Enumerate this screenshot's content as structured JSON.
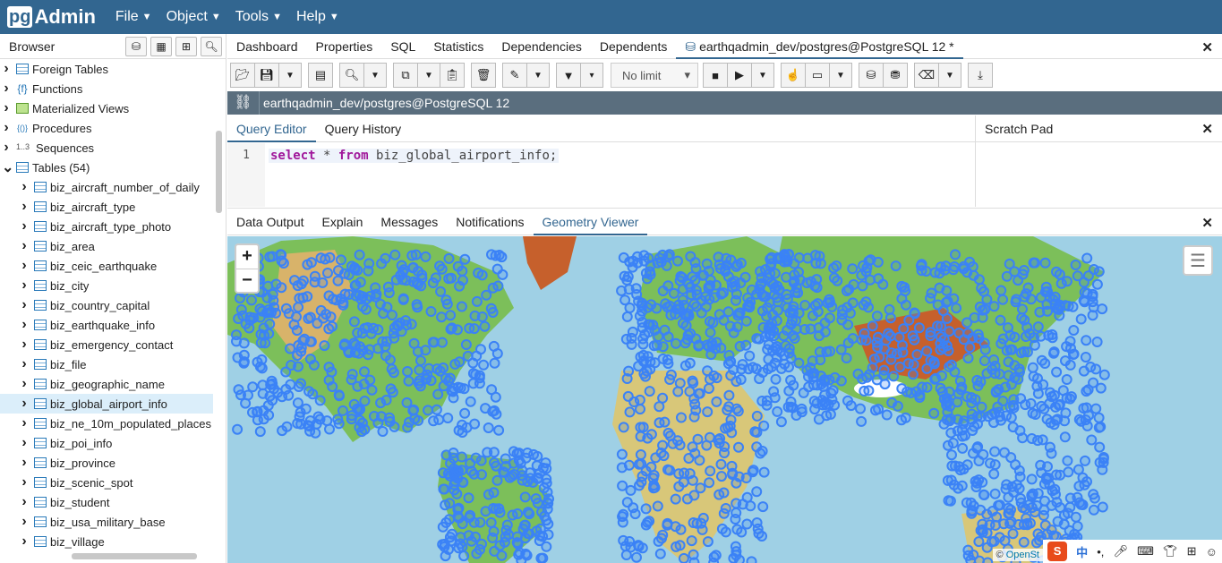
{
  "app": {
    "logo_pg": "pg",
    "logo_admin": "Admin",
    "menu": [
      {
        "label": "File"
      },
      {
        "label": "Object"
      },
      {
        "label": "Tools"
      },
      {
        "label": "Help"
      }
    ]
  },
  "browser": {
    "title": "Browser",
    "tree": [
      {
        "label": "Foreign Tables",
        "indent": 0,
        "icon": "foreign-table-icon"
      },
      {
        "label": "Functions",
        "indent": 0,
        "icon": "function-icon"
      },
      {
        "label": "Materialized Views",
        "indent": 0,
        "icon": "materialized-view-icon"
      },
      {
        "label": "Procedures",
        "indent": 0,
        "icon": "procedure-icon"
      },
      {
        "label": "Sequences",
        "indent": 0,
        "icon": "sequence-icon"
      },
      {
        "label": "Tables (54)",
        "indent": 0,
        "icon": "tables-icon",
        "expanded": true
      },
      {
        "label": "biz_aircraft_number_of_daily",
        "indent": 1,
        "icon": "table-icon"
      },
      {
        "label": "biz_aircraft_type",
        "indent": 1,
        "icon": "table-icon"
      },
      {
        "label": "biz_aircraft_type_photo",
        "indent": 1,
        "icon": "table-icon"
      },
      {
        "label": "biz_area",
        "indent": 1,
        "icon": "table-icon"
      },
      {
        "label": "biz_ceic_earthquake",
        "indent": 1,
        "icon": "table-icon"
      },
      {
        "label": "biz_city",
        "indent": 1,
        "icon": "table-icon"
      },
      {
        "label": "biz_country_capital",
        "indent": 1,
        "icon": "table-icon"
      },
      {
        "label": "biz_earthquake_info",
        "indent": 1,
        "icon": "table-icon"
      },
      {
        "label": "biz_emergency_contact",
        "indent": 1,
        "icon": "table-icon"
      },
      {
        "label": "biz_file",
        "indent": 1,
        "icon": "table-icon"
      },
      {
        "label": "biz_geographic_name",
        "indent": 1,
        "icon": "table-icon"
      },
      {
        "label": "biz_global_airport_info",
        "indent": 1,
        "icon": "table-icon",
        "selected": true
      },
      {
        "label": "biz_ne_10m_populated_places",
        "indent": 1,
        "icon": "table-icon"
      },
      {
        "label": "biz_poi_info",
        "indent": 1,
        "icon": "table-icon"
      },
      {
        "label": "biz_province",
        "indent": 1,
        "icon": "table-icon"
      },
      {
        "label": "biz_scenic_spot",
        "indent": 1,
        "icon": "table-icon"
      },
      {
        "label": "biz_student",
        "indent": 1,
        "icon": "table-icon"
      },
      {
        "label": "biz_usa_military_base",
        "indent": 1,
        "icon": "table-icon"
      },
      {
        "label": "biz_village",
        "indent": 1,
        "icon": "table-icon"
      }
    ]
  },
  "tabs": [
    {
      "label": "Dashboard"
    },
    {
      "label": "Properties"
    },
    {
      "label": "SQL"
    },
    {
      "label": "Statistics"
    },
    {
      "label": "Dependencies"
    },
    {
      "label": "Dependents"
    },
    {
      "label": "earthqadmin_dev/postgres@PostgreSQL 12 *",
      "active": true
    }
  ],
  "toolbar": {
    "limit": "No limit"
  },
  "connection": "earthqadmin_dev/postgres@PostgreSQL 12",
  "query_tabs": [
    {
      "label": "Query Editor",
      "active": true
    },
    {
      "label": "Query History"
    }
  ],
  "scratch_pad": "Scratch Pad",
  "editor": {
    "line_number": "1",
    "kw_select": "select",
    "star": " * ",
    "kw_from": "from",
    "rest": " biz_global_airport_info;"
  },
  "result_tabs": [
    {
      "label": "Data Output"
    },
    {
      "label": "Explain"
    },
    {
      "label": "Messages"
    },
    {
      "label": "Notifications"
    },
    {
      "label": "Geometry Viewer",
      "active": true
    }
  ],
  "map": {
    "zoom_in": "+",
    "zoom_out": "−",
    "attribution_prefix": "© ",
    "attribution_link": "OpenSt",
    "colors": {
      "ocean": "#9fd0e5",
      "points": "#3b82f6",
      "land_low": "#7cbf5a",
      "land_high": "#c6602c"
    }
  },
  "ime": {
    "logo": "S",
    "lang": "中"
  }
}
